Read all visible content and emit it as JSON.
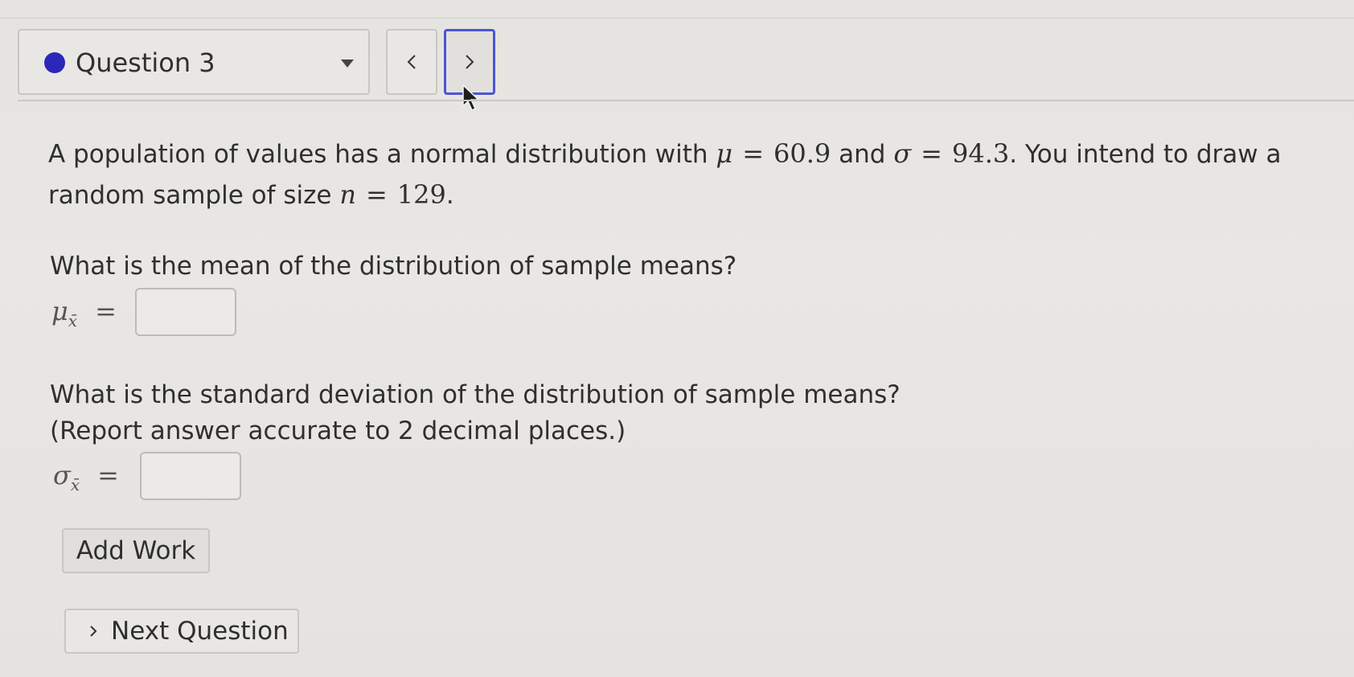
{
  "header": {
    "question_label": "Question 3",
    "status_color": "#2c27b8",
    "prev_icon": "chevron-left-icon",
    "next_icon": "chevron-right-icon"
  },
  "problem": {
    "intro_text_1": "A population of values has a normal distribution with",
    "mu_symbol": "μ",
    "equals": "=",
    "mu_value": "60.9",
    "and_text": "and",
    "sigma_symbol": "σ",
    "sigma_value": "94.3",
    "intro_text_2": ". You intend to draw a random sample of size",
    "n_symbol": "n",
    "n_value": "129",
    "period": "."
  },
  "part1": {
    "question": "What is the mean of the distribution of sample means?",
    "label_symbol": "μ",
    "label_subscript": "x̄",
    "label_equals": "=",
    "input_value": ""
  },
  "part2": {
    "question_line1": "What is the standard deviation of the distribution of sample means?",
    "question_line2": "(Report answer accurate to 2 decimal places.)",
    "label_symbol": "σ",
    "label_subscript": "x̄",
    "label_equals": "=",
    "input_value": ""
  },
  "actions": {
    "add_work_label": "Add Work",
    "next_question_label": "Next Question"
  }
}
